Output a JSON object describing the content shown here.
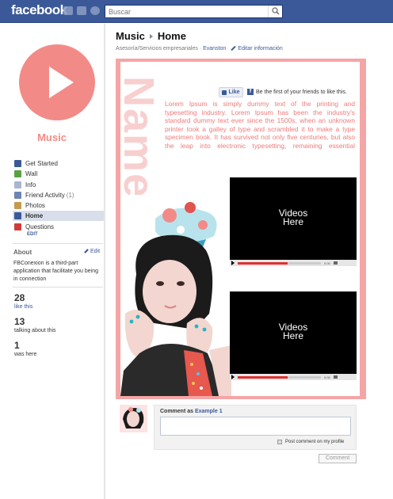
{
  "topbar": {
    "logo": "facebook",
    "search_placeholder": "Buscar"
  },
  "sidebar": {
    "page_name": "Music",
    "nav": [
      {
        "label": "Get Started",
        "icon": "get-started-icon",
        "color": "#3b5998",
        "active": false,
        "count": ""
      },
      {
        "label": "Wall",
        "icon": "wall-icon",
        "color": "#5aa143",
        "active": false,
        "count": ""
      },
      {
        "label": "Info",
        "icon": "info-icon",
        "color": "#a9b6cf",
        "active": false,
        "count": ""
      },
      {
        "label": "Friend Activity",
        "icon": "friend-activity-icon",
        "color": "#6d84b4",
        "active": false,
        "count": "(1)"
      },
      {
        "label": "Photos",
        "icon": "photos-icon",
        "color": "#c59a4f",
        "active": false,
        "count": ""
      },
      {
        "label": "Home",
        "icon": "home-icon",
        "color": "#3b5998",
        "active": true,
        "count": ""
      },
      {
        "label": "Questions",
        "icon": "questions-icon",
        "color": "#d23a3a",
        "active": false,
        "count": ""
      }
    ],
    "nav_edit": "EDIT",
    "about": {
      "title": "About",
      "edit": "Edit",
      "text": "FBConexion is a third-part application that facilitate you being in connection"
    },
    "stats": [
      {
        "num": "28",
        "label": "like this",
        "link": true
      },
      {
        "num": "13",
        "label": "talking about this",
        "link": false
      },
      {
        "num": "1",
        "label": "was here",
        "link": false
      }
    ]
  },
  "header": {
    "crumb_parent": "Music",
    "crumb_current": "Home",
    "category": "Asesoría/Servicios empresariales",
    "sep": " · ",
    "location": "Evanston",
    "edit_info": "Editar información"
  },
  "card": {
    "watermark": "Name",
    "like_label": "Like",
    "like_text": "Be the first of your friends to like this.",
    "lorem": "Lorem Ipsum is simply dummy text of the printing and typesetting industry. Lorem Ipsum has been the industry's standard dummy text ever since the 1500s, when an unknown printer took a galley of type and scrambled it to make a type specimen book. It has survived not only five centuries, but also the leap into electronic typesetting, remaining essential",
    "video1_l1": "Videos",
    "video1_l2": "Here",
    "video2_l1": "Videos",
    "video2_l2": "Here",
    "video_progress": 0.6,
    "accent": "#f5a5a5",
    "text_color": "#f07a7a"
  },
  "comment": {
    "label_prefix": "Comment as",
    "label_user": "Example 1",
    "post_label": "Post comment on my profile",
    "button": "Comment"
  }
}
